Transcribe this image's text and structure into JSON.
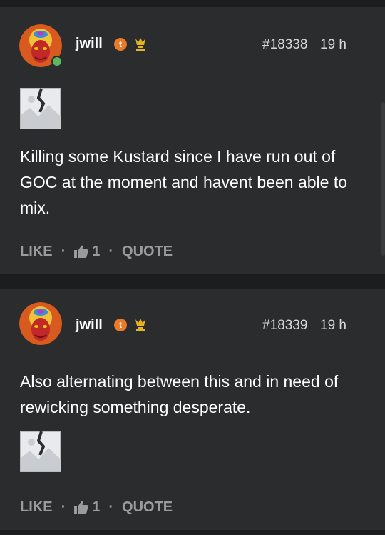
{
  "posts": [
    {
      "username": "jwill",
      "badge_letter": "t",
      "post_number": "#18338",
      "time": "19 h",
      "content": "Killing some Kustard since I have run out of GOC at the moment and havent been able to mix.",
      "like_label": "LIKE",
      "like_count": "1",
      "quote_label": "QUOTE",
      "separator": "·"
    },
    {
      "username": "jwill",
      "badge_letter": "t",
      "post_number": "#18339",
      "time": "19 h",
      "content": "Also alternating between this and in need of rewicking something desperate.",
      "like_label": "LIKE",
      "like_count": "1",
      "quote_label": "QUOTE",
      "separator": "·"
    }
  ],
  "colors": {
    "background": "#1c1d1f",
    "card": "#2b2c2e",
    "badge_orange": "#e87a2b",
    "crown_gold": "#e6b422",
    "online_green": "#5cb85c",
    "muted_text": "#9a9b9d"
  },
  "icons": [
    "avatar-image",
    "online-status-icon",
    "badge-icon",
    "crown-icon",
    "broken-image-icon",
    "thumbs-up-icon"
  ]
}
